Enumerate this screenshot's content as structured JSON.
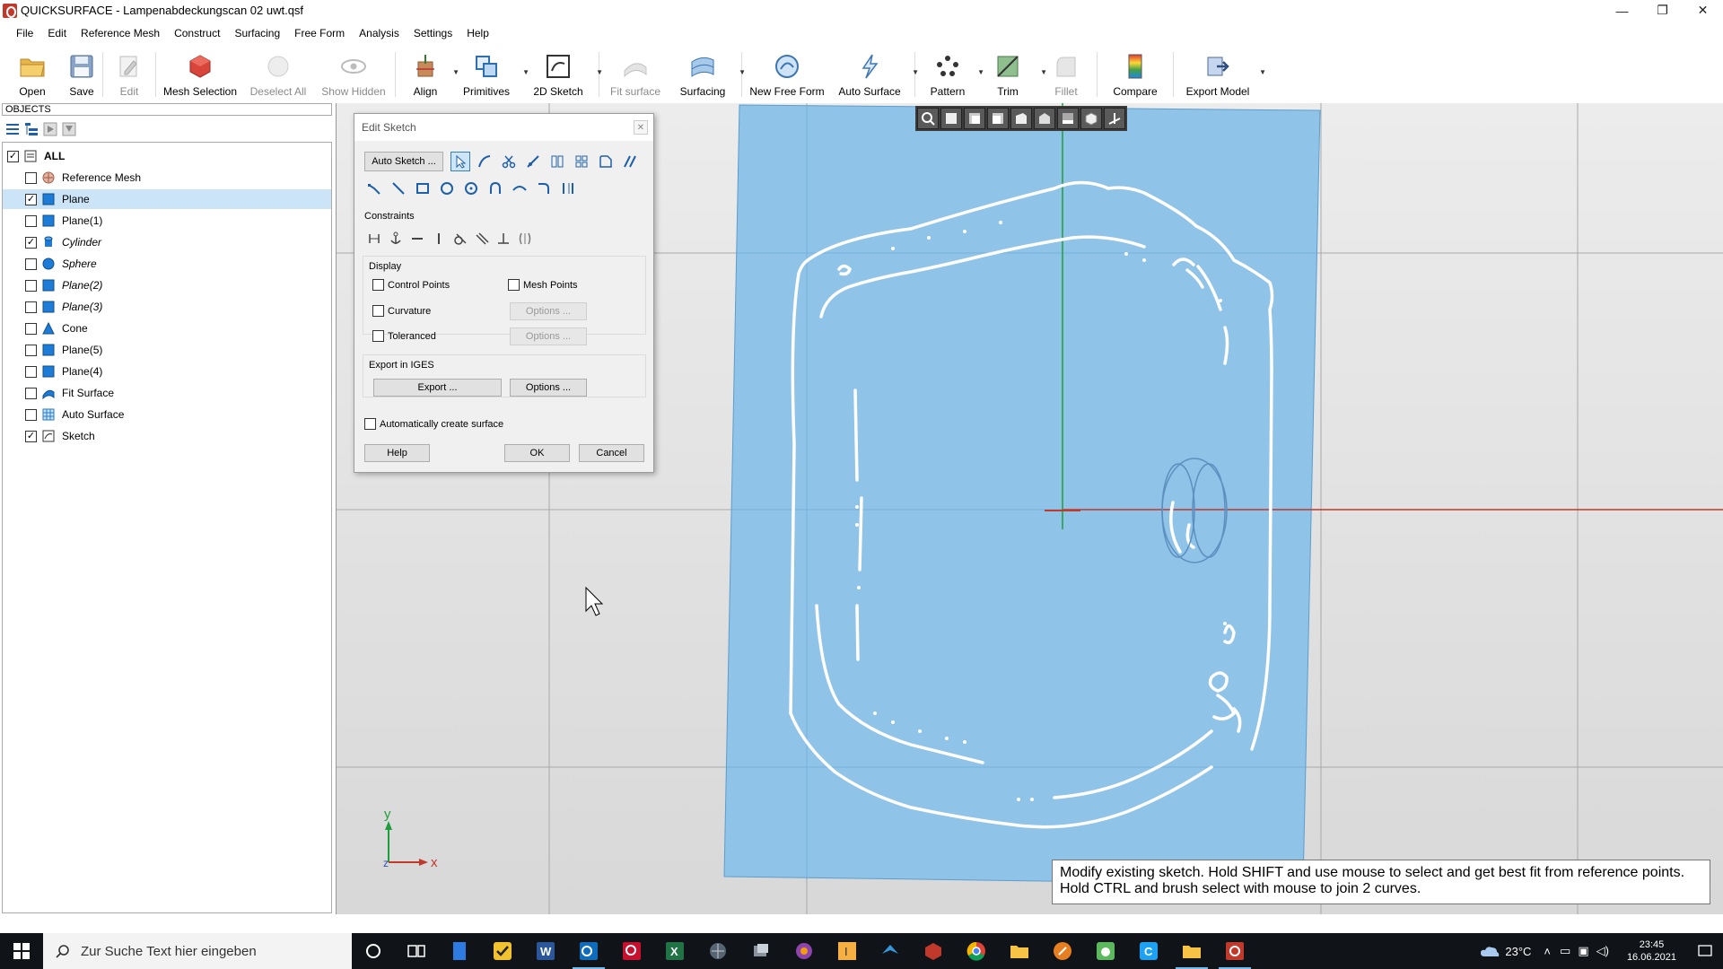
{
  "window": {
    "title": "QUICKSURFACE - Lampenabdeckungscan 02 uwt.qsf",
    "minimize": "—",
    "restore": "❐",
    "close": "✕"
  },
  "menu": [
    "File",
    "Edit",
    "Reference Mesh",
    "Construct",
    "Surfacing",
    "Free Form",
    "Analysis",
    "Settings",
    "Help"
  ],
  "toolbar": {
    "open": "Open",
    "save": "Save",
    "edit": "Edit",
    "mesh_selection": "Mesh Selection",
    "deselect_all": "Deselect All",
    "show_hidden": "Show Hidden",
    "align": "Align",
    "primitives": "Primitives",
    "sketch_2d": "2D Sketch",
    "fit_surface": "Fit surface",
    "surfacing": "Surfacing",
    "new_free_form": "New Free Form",
    "auto_surface": "Auto Surface",
    "pattern": "Pattern",
    "trim": "Trim",
    "fillet": "Fillet",
    "compare": "Compare",
    "export_model": "Export Model"
  },
  "objects_panel": {
    "header": "OBJECTS",
    "items": [
      {
        "label": "ALL",
        "checked": "✓"
      },
      {
        "label": "Reference Mesh",
        "checked": ""
      },
      {
        "label": "Plane",
        "checked": "✓"
      },
      {
        "label": "Plane(1)",
        "checked": ""
      },
      {
        "label": "Cylinder",
        "checked": "✓"
      },
      {
        "label": "Sphere",
        "checked": ""
      },
      {
        "label": "Plane(2)",
        "checked": ""
      },
      {
        "label": "Plane(3)",
        "checked": ""
      },
      {
        "label": "Cone",
        "checked": ""
      },
      {
        "label": "Plane(5)",
        "checked": ""
      },
      {
        "label": "Plane(4)",
        "checked": ""
      },
      {
        "label": "Fit Surface",
        "checked": ""
      },
      {
        "label": "Auto Surface",
        "checked": ""
      },
      {
        "label": "Sketch",
        "checked": "✓"
      }
    ]
  },
  "dialog": {
    "title": "Edit Sketch",
    "auto_sketch": "Auto Sketch ...",
    "constraints_label": "Constraints",
    "display_label": "Display",
    "control_points": "Control Points",
    "mesh_points": "Mesh Points",
    "curvature": "Curvature",
    "toleranced": "Toleranced",
    "options_disabled": "Options ...",
    "export_iges_label": "Export in IGES",
    "export_btn": "Export ...",
    "options_btn": "Options ...",
    "auto_create_surface": "Automatically create surface",
    "help": "Help",
    "ok": "OK",
    "cancel": "Cancel"
  },
  "axes": {
    "y": "y",
    "x": "x",
    "z": "z"
  },
  "tooltip": {
    "line1": "Modify existing sketch. Hold SHIFT and use mouse to select and get best fit from reference points.",
    "line2": "Hold CTRL and brush select with mouse to join 2 curves."
  },
  "taskbar": {
    "search_placeholder": "Zur Suche Text hier eingeben",
    "temperature": "23°C",
    "time": "23:45",
    "date": "16.06.2021"
  },
  "colors": {
    "plane_blue": "#8fc3e8",
    "axis_red": "#c0392b",
    "axis_green": "#1e9e3a"
  }
}
